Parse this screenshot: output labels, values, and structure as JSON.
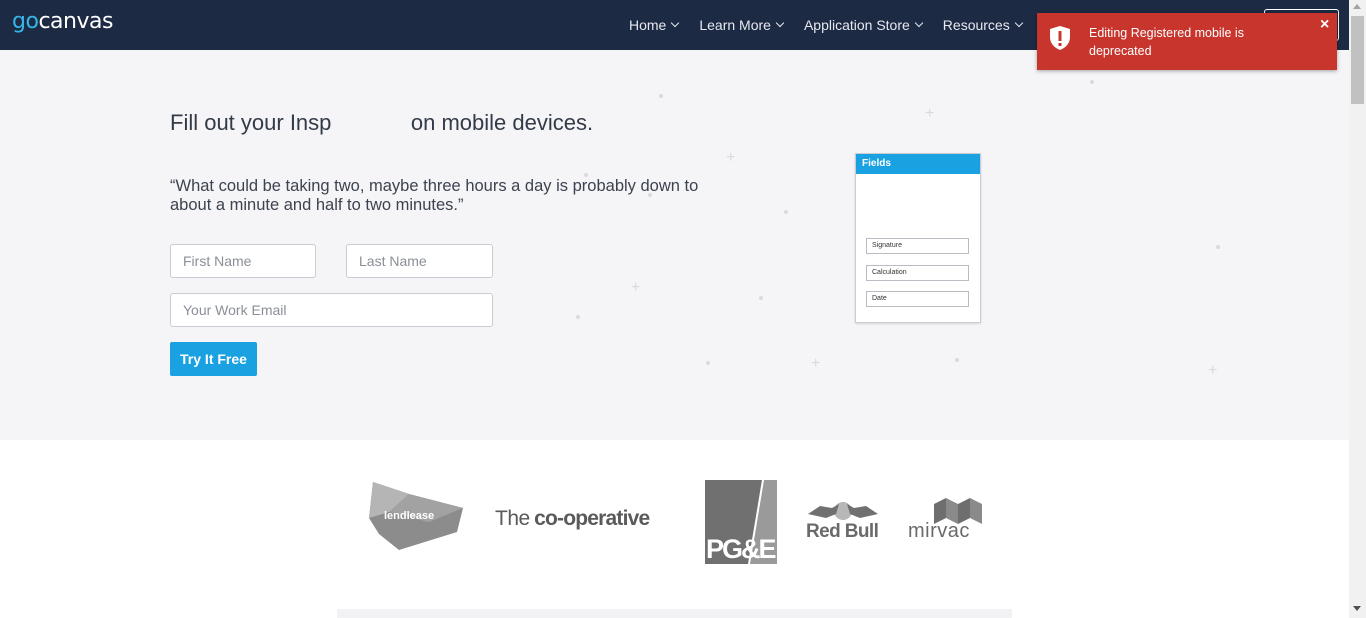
{
  "nav": {
    "logo_go": "go",
    "logo_rest": "canvas",
    "items": [
      {
        "label": "Home"
      },
      {
        "label": "Learn More"
      },
      {
        "label": "Application Store"
      },
      {
        "label": "Resources"
      }
    ]
  },
  "hero": {
    "headline_start": "Fill out your Insp",
    "headline_end": "on mobile devices.",
    "quote": "“What could be taking two, maybe three hours a day is probably down to about a minute and half to two minutes.”",
    "first_name_placeholder": "First Name",
    "last_name_placeholder": "Last Name",
    "email_placeholder": "Your Work Email",
    "cta_label": "Try It Free"
  },
  "phone_card": {
    "header": "Fields",
    "fields": [
      "Signature",
      "Calculation",
      "Date"
    ]
  },
  "logos": {
    "lendlease": "lendlease",
    "cooperative_the": "The",
    "cooperative_name": "co-operative",
    "pge": "PG&E",
    "redbull": "Red Bull",
    "mirvac": "mirvac"
  },
  "toast": {
    "message": "Editing Registered mobile is deprecated",
    "close": "×"
  },
  "colors": {
    "nav_bg": "#1d2a44",
    "accent": "#1aa1e2",
    "toast_bg": "#c8352d",
    "hero_bg": "#f5f4f7"
  }
}
